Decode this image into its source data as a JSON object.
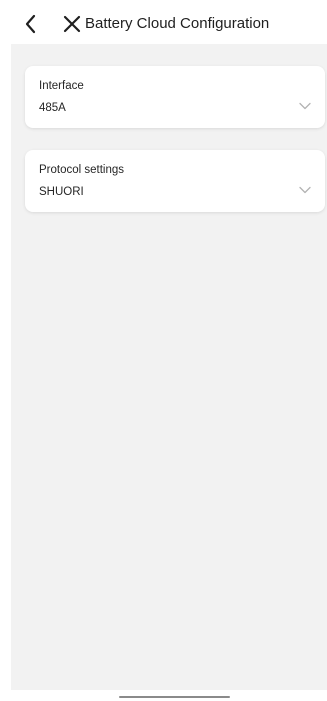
{
  "header": {
    "title": "Battery Cloud Configuration"
  },
  "fields": {
    "interface": {
      "label": "Interface",
      "value": "485A"
    },
    "protocol": {
      "label": "Protocol settings",
      "value": "SHUORI"
    }
  }
}
